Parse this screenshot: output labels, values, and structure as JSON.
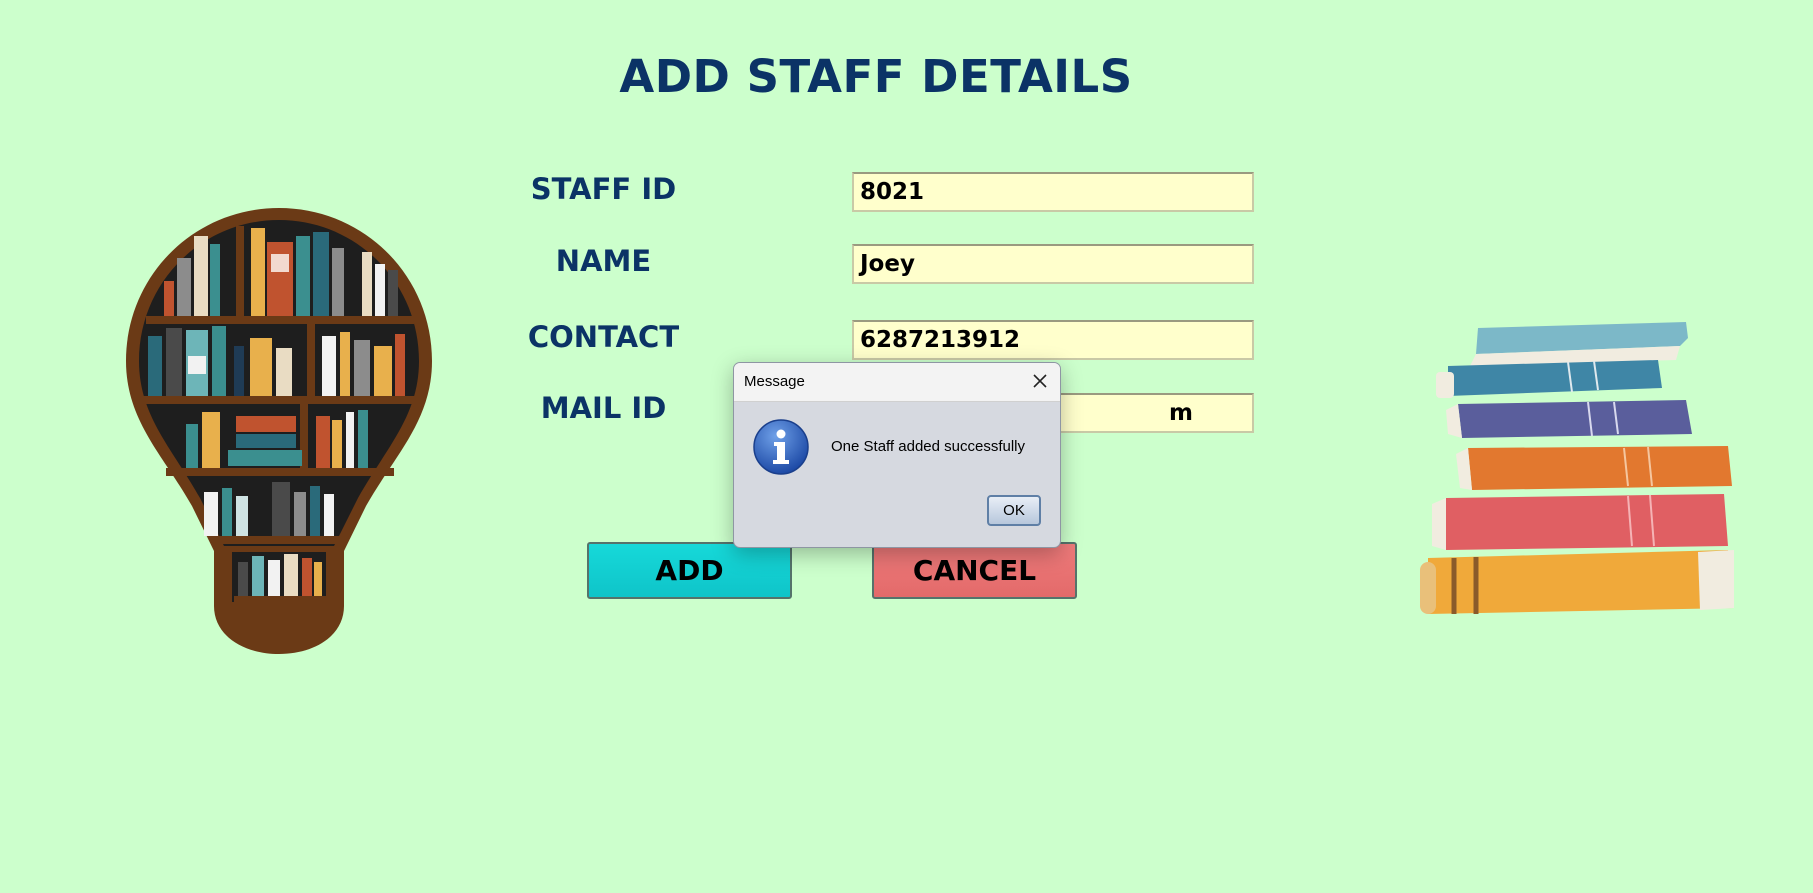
{
  "page": {
    "title": "ADD STAFF DETAILS"
  },
  "form": {
    "staff_id": {
      "label": "STAFF ID",
      "value": "8021"
    },
    "name": {
      "label": "NAME",
      "value": "Joey"
    },
    "contact": {
      "label": "CONTACT",
      "value": "6287213912"
    },
    "mail_id": {
      "label": "MAIL ID",
      "value": "m"
    }
  },
  "buttons": {
    "add": "ADD",
    "cancel": "CANCEL"
  },
  "dialog": {
    "title": "Message",
    "message": "One Staff added successfully",
    "ok": "OK",
    "icon": "info-icon"
  },
  "icons": {
    "close": "close-icon",
    "bulb_bookshelf": "lightbulb-bookshelf-illustration",
    "book_stack": "book-stack-illustration"
  },
  "colors": {
    "background": "#ccffcc",
    "heading": "#0b3366",
    "field_bg": "#ffffcc",
    "add_button": "#12cfd3",
    "cancel_button": "#e87070"
  }
}
